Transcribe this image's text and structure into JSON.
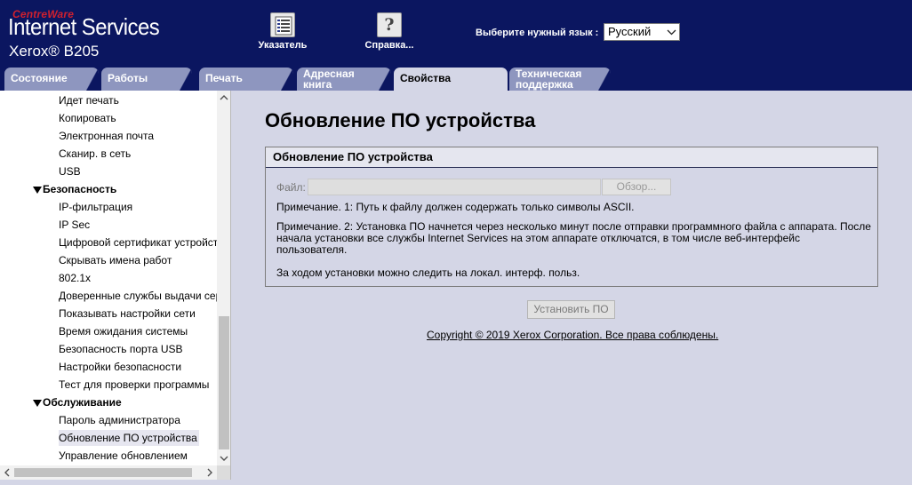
{
  "header": {
    "brand_small": "CentreWare",
    "brand_title": "Internet Services",
    "model": "Xerox® B205",
    "index_label": "Указатель",
    "help_label": "Справка...",
    "language_label": "Выберите нужный язык :",
    "language_value": "Русский"
  },
  "tabs": [
    {
      "label": "Состояние"
    },
    {
      "label": "Работы"
    },
    {
      "label": "Печать"
    },
    {
      "label": "Адресная книга"
    },
    {
      "label": "Свойства",
      "active": true
    },
    {
      "label": "Техническая поддержка"
    }
  ],
  "nav": {
    "top_items": [
      "Идет печать",
      "Копировать",
      "Электронная почта",
      "Сканир. в сеть",
      "USB"
    ],
    "security_header": "Безопасность",
    "security_items": [
      "IP-фильтрация",
      "IP Sec",
      "Цифровой сертификат устройства",
      "Скрывать имена работ",
      "802.1x",
      "Доверенные службы выдачи сертификатов",
      "Показывать настройки сети",
      "Время ожидания системы",
      "Безопасность порта USB",
      "Настройки безопасности",
      "Тест для проверки программы"
    ],
    "maintenance_header": "Обслуживание",
    "maintenance_items": [
      "Пароль администратора",
      "Обновление ПО устройства",
      "Управление обновлением"
    ],
    "selected": "Обновление ПО устройства"
  },
  "main": {
    "title": "Обновление ПО устройства",
    "panel_title": "Обновление ПО устройства",
    "file_label": "Файл:",
    "file_value": "",
    "browse_label": "Обзор...",
    "note1": "Примечание. 1: Путь к файлу должен содержать только символы ASCII.",
    "note2": "Примечание. 2: Установка ПО начнется через несколько минут после отправки программного файла с аппарата. После начала установки все службы Internet Services на этом аппарате отключатся, в том числе веб-интерфейс пользователя.",
    "note3": "За ходом установки можно следить на локал. интерф. польз.",
    "install_label": "Установить ПО",
    "copyright": "Copyright © 2019 Xerox Corporation. Все права соблюдены."
  },
  "colors": {
    "header_bg": "#0b1660",
    "tab_inactive": "#8e96bf",
    "page_bg": "#d4d6e6",
    "brand_red": "#d0202e"
  }
}
